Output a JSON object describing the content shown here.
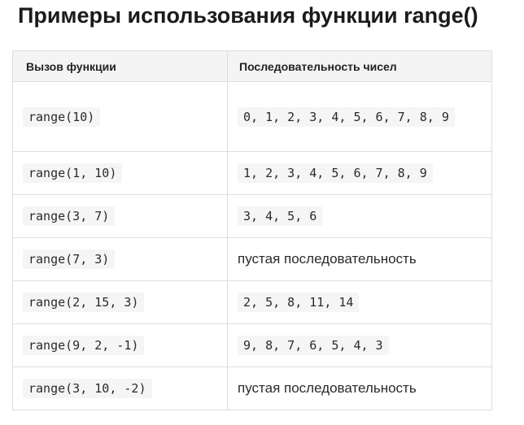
{
  "page": {
    "title": "Примеры использования функции range()"
  },
  "table": {
    "headers": [
      "Вызов функции",
      "Последовательность чисел"
    ],
    "rows": [
      {
        "call": "range(10)",
        "result": "0, 1, 2, 3, 4, 5, 6, 7, 8, 9",
        "result_is_code": true
      },
      {
        "call": "range(1, 10)",
        "result": "1, 2, 3, 4, 5, 6, 7, 8, 9",
        "result_is_code": true
      },
      {
        "call": "range(3, 7)",
        "result": "3, 4, 5, 6",
        "result_is_code": true
      },
      {
        "call": "range(7, 3)",
        "result": "пустая последовательность",
        "result_is_code": false
      },
      {
        "call": "range(2, 15, 3)",
        "result": "2, 5, 8, 11, 14",
        "result_is_code": true
      },
      {
        "call": "range(9, 2, -1)",
        "result": "9, 8, 7, 6, 5, 4, 3",
        "result_is_code": true
      },
      {
        "call": "range(3, 10, -2)",
        "result": "пустая последовательность",
        "result_is_code": false
      }
    ]
  }
}
